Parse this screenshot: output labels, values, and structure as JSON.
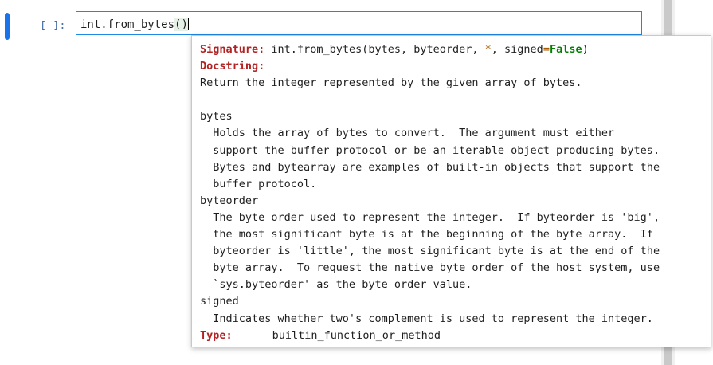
{
  "cell": {
    "prompt": "[ ]:",
    "code": {
      "prefix": "int.from_bytes",
      "paren_open": "(",
      "paren_close": ")"
    }
  },
  "tooltip": {
    "signature_label": "Signature:",
    "signature": {
      "fn": "int.from_bytes(bytes, byteorder, ",
      "star": "*",
      "mid": ", signed",
      "eq": "=",
      "default": "False",
      "close": ")"
    },
    "docstring_label": "Docstring:",
    "summary": "Return the integer represented by the given array of bytes.",
    "blank": "",
    "params": [
      {
        "name": "bytes",
        "lines": [
          "  Holds the array of bytes to convert.  The argument must either",
          "  support the buffer protocol or be an iterable object producing bytes.",
          "  Bytes and bytearray are examples of built-in objects that support the",
          "  buffer protocol."
        ]
      },
      {
        "name": "byteorder",
        "lines": [
          "  The byte order used to represent the integer.  If byteorder is 'big',",
          "  the most significant byte is at the beginning of the byte array.  If",
          "  byteorder is 'little', the most significant byte is at the end of the",
          "  byte array.  To request the native byte order of the host system, use",
          "  `sys.byteorder' as the byte order value."
        ]
      },
      {
        "name": "signed",
        "lines": [
          "  Indicates whether two's complement is used to represent the integer."
        ]
      }
    ],
    "type_label": "Type:",
    "type_value": "builtin_function_or_method"
  },
  "colors": {
    "cell_marker": "#1a73e8",
    "input_border": "#1e88e5",
    "label_red": "#b22222",
    "keyword_green": "#008000",
    "operator_orange": "#aa5500"
  }
}
